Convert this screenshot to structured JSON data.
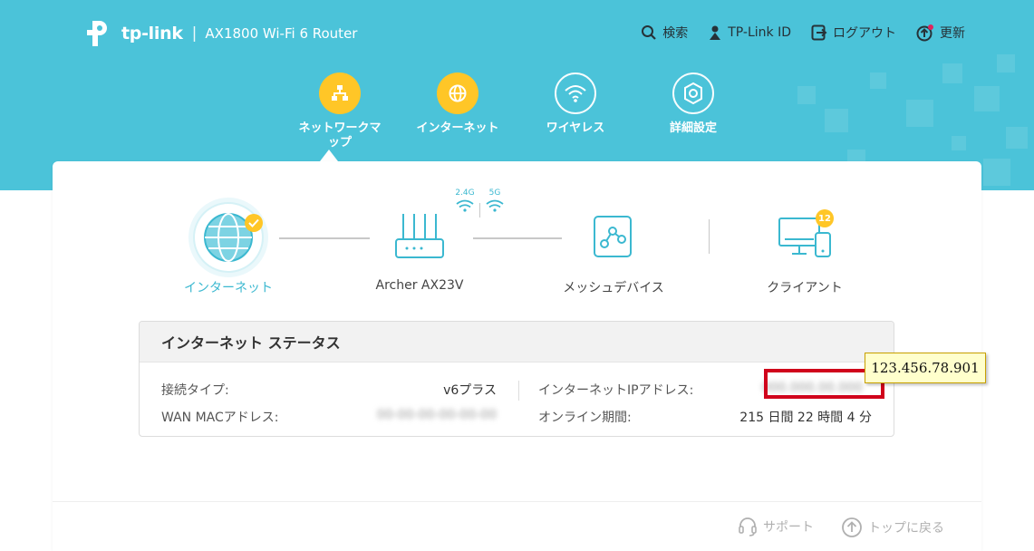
{
  "header": {
    "brand": "tp-link",
    "model": "AX1800 Wi-Fi 6 Router",
    "links": [
      {
        "label": "検索",
        "icon": "search-icon"
      },
      {
        "label": "TP-Link ID",
        "icon": "user-icon"
      },
      {
        "label": "ログアウト",
        "icon": "logout-icon"
      },
      {
        "label": "更新",
        "icon": "update-icon"
      }
    ]
  },
  "nav": [
    {
      "label": "ネットワークマップ",
      "icon": "network-map-icon",
      "active": true
    },
    {
      "label": "インターネット",
      "icon": "globe-icon",
      "active": false
    },
    {
      "label": "ワイヤレス",
      "icon": "wifi-icon",
      "active": false
    },
    {
      "label": "詳細設定",
      "icon": "gear-icon",
      "active": false
    }
  ],
  "topology": {
    "internet": "インターネット",
    "router": "Archer AX23V",
    "band_24": "2.4G",
    "band_5": "5G",
    "mesh": "メッシュデバイス",
    "clients": "クライアント",
    "client_count": "12"
  },
  "status": {
    "title": "インターネット ステータス",
    "conn_type_label": "接続タイプ:",
    "conn_type_value": "v6プラス",
    "wan_mac_label": "WAN MACアドレス:",
    "wan_mac_value": "00-00-00-00-00-00",
    "ip_label": "インターネットIPアドレス:",
    "ip_value": "000.000.00.000",
    "uptime_label": "オンライン期間:",
    "uptime_value": "215 日間 22 時間 4 分"
  },
  "callout": {
    "text": "123.456.78.901"
  },
  "footer": {
    "support": "サポート",
    "back_to_top": "トップに戻る"
  },
  "colors": {
    "band": "#4bc3d9",
    "accent": "#ffc627",
    "active_text": "#3bb8d0",
    "highlight_border": "#d0021b",
    "tooltip_bg": "#ffffcc"
  }
}
